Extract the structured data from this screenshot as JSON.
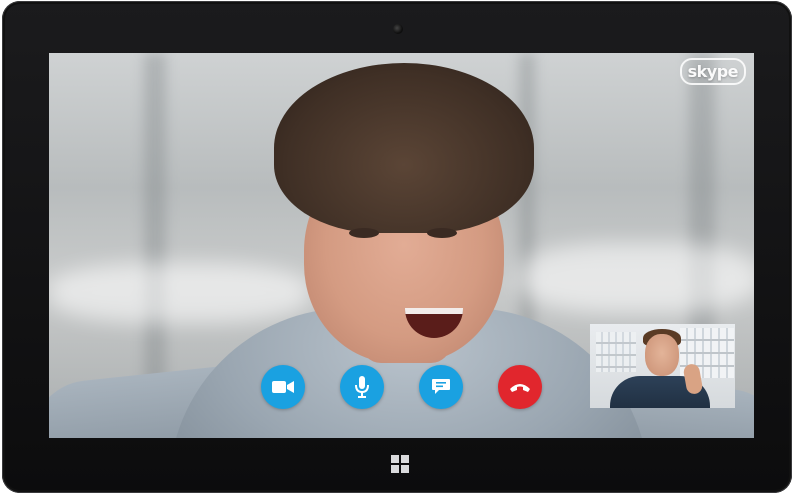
{
  "app": {
    "logo_text": "skype"
  },
  "call_controls": [
    {
      "id": "video",
      "icon": "video-camera-icon",
      "color": "#1aa1e1"
    },
    {
      "id": "mic",
      "icon": "microphone-icon",
      "color": "#1aa1e1"
    },
    {
      "id": "im",
      "icon": "chat-bubble-icon",
      "color": "#1aa1e1"
    },
    {
      "id": "end",
      "icon": "hang-up-phone-icon",
      "color": "#e1262d"
    }
  ],
  "device": {
    "home_button_icon": "windows-logo-icon"
  }
}
